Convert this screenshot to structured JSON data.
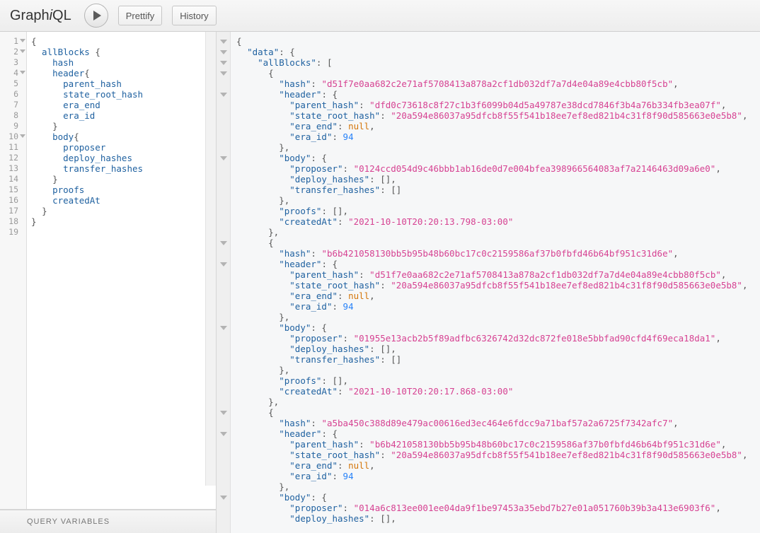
{
  "header": {
    "logo_graph": "Graph",
    "logo_i": "i",
    "logo_ql": "QL",
    "execute_label": "",
    "prettify_label": "Prettify",
    "history_label": "History"
  },
  "editor": {
    "variables_label": "QUERY VARIABLES",
    "lines": [
      {
        "n": "1",
        "fold": true,
        "text": "{"
      },
      {
        "n": "2",
        "fold": true,
        "text": "  allBlocks {"
      },
      {
        "n": "3",
        "fold": false,
        "text": "    hash"
      },
      {
        "n": "4",
        "fold": true,
        "text": "    header{"
      },
      {
        "n": "5",
        "fold": false,
        "text": "      parent_hash"
      },
      {
        "n": "6",
        "fold": false,
        "text": "      state_root_hash"
      },
      {
        "n": "7",
        "fold": false,
        "text": "      era_end"
      },
      {
        "n": "8",
        "fold": false,
        "text": "      era_id"
      },
      {
        "n": "9",
        "fold": false,
        "text": "    }"
      },
      {
        "n": "10",
        "fold": true,
        "text": "    body{"
      },
      {
        "n": "11",
        "fold": false,
        "text": "      proposer"
      },
      {
        "n": "12",
        "fold": false,
        "text": "      deploy_hashes"
      },
      {
        "n": "13",
        "fold": false,
        "text": "      transfer_hashes"
      },
      {
        "n": "14",
        "fold": false,
        "text": "    }"
      },
      {
        "n": "15",
        "fold": false,
        "text": "    proofs"
      },
      {
        "n": "16",
        "fold": false,
        "text": "    createdAt"
      },
      {
        "n": "17",
        "fold": false,
        "text": "  }"
      },
      {
        "n": "18",
        "fold": false,
        "text": "}"
      },
      {
        "n": "19",
        "fold": false,
        "text": ""
      }
    ]
  },
  "result": {
    "lines": [
      {
        "fold": true,
        "indent": 0,
        "parts": [
          {
            "t": "{",
            "c": "p"
          }
        ]
      },
      {
        "fold": true,
        "indent": 1,
        "parts": [
          {
            "t": "\"data\"",
            "c": "k"
          },
          {
            "t": ": {",
            "c": "p"
          }
        ]
      },
      {
        "fold": true,
        "indent": 2,
        "parts": [
          {
            "t": "\"allBlocks\"",
            "c": "k"
          },
          {
            "t": ": [",
            "c": "p"
          }
        ]
      },
      {
        "fold": true,
        "indent": 3,
        "parts": [
          {
            "t": "{",
            "c": "p"
          }
        ]
      },
      {
        "fold": false,
        "indent": 4,
        "parts": [
          {
            "t": "\"hash\"",
            "c": "k"
          },
          {
            "t": ": ",
            "c": "p"
          },
          {
            "t": "\"d51f7e0aa682c2e71af5708413a878a2cf1db032df7a7d4e04a89e4cbb80f5cb\"",
            "c": "s"
          },
          {
            "t": ",",
            "c": "p"
          }
        ]
      },
      {
        "fold": true,
        "indent": 4,
        "parts": [
          {
            "t": "\"header\"",
            "c": "k"
          },
          {
            "t": ": {",
            "c": "p"
          }
        ]
      },
      {
        "fold": false,
        "indent": 5,
        "parts": [
          {
            "t": "\"parent_hash\"",
            "c": "k"
          },
          {
            "t": ": ",
            "c": "p"
          },
          {
            "t": "\"dfd0c73618c8f27c1b3f6099b04d5a49787e38dcd7846f3b4a76b334fb3ea07f\"",
            "c": "s"
          },
          {
            "t": ",",
            "c": "p"
          }
        ]
      },
      {
        "fold": false,
        "indent": 5,
        "parts": [
          {
            "t": "\"state_root_hash\"",
            "c": "k"
          },
          {
            "t": ": ",
            "c": "p"
          },
          {
            "t": "\"20a594e86037a95dfcb8f55f541b18ee7ef8ed821b4c31f8f90d585663e0e5b8\"",
            "c": "s"
          },
          {
            "t": ",",
            "c": "p"
          }
        ]
      },
      {
        "fold": false,
        "indent": 5,
        "parts": [
          {
            "t": "\"era_end\"",
            "c": "k"
          },
          {
            "t": ": ",
            "c": "p"
          },
          {
            "t": "null",
            "c": "nul"
          },
          {
            "t": ",",
            "c": "p"
          }
        ]
      },
      {
        "fold": false,
        "indent": 5,
        "parts": [
          {
            "t": "\"era_id\"",
            "c": "k"
          },
          {
            "t": ": ",
            "c": "p"
          },
          {
            "t": "94",
            "c": "n"
          }
        ]
      },
      {
        "fold": false,
        "indent": 4,
        "parts": [
          {
            "t": "},",
            "c": "p"
          }
        ]
      },
      {
        "fold": true,
        "indent": 4,
        "parts": [
          {
            "t": "\"body\"",
            "c": "k"
          },
          {
            "t": ": {",
            "c": "p"
          }
        ]
      },
      {
        "fold": false,
        "indent": 5,
        "parts": [
          {
            "t": "\"proposer\"",
            "c": "k"
          },
          {
            "t": ": ",
            "c": "p"
          },
          {
            "t": "\"0124ccd054d9c46bbb1ab16de0d7e004bfea398966564083af7a2146463d09a6e0\"",
            "c": "s"
          },
          {
            "t": ",",
            "c": "p"
          }
        ]
      },
      {
        "fold": false,
        "indent": 5,
        "parts": [
          {
            "t": "\"deploy_hashes\"",
            "c": "k"
          },
          {
            "t": ": [],",
            "c": "p"
          }
        ]
      },
      {
        "fold": false,
        "indent": 5,
        "parts": [
          {
            "t": "\"transfer_hashes\"",
            "c": "k"
          },
          {
            "t": ": []",
            "c": "p"
          }
        ]
      },
      {
        "fold": false,
        "indent": 4,
        "parts": [
          {
            "t": "},",
            "c": "p"
          }
        ]
      },
      {
        "fold": false,
        "indent": 4,
        "parts": [
          {
            "t": "\"proofs\"",
            "c": "k"
          },
          {
            "t": ": [],",
            "c": "p"
          }
        ]
      },
      {
        "fold": false,
        "indent": 4,
        "parts": [
          {
            "t": "\"createdAt\"",
            "c": "k"
          },
          {
            "t": ": ",
            "c": "p"
          },
          {
            "t": "\"2021-10-10T20:20:13.798-03:00\"",
            "c": "s"
          }
        ]
      },
      {
        "fold": false,
        "indent": 3,
        "parts": [
          {
            "t": "},",
            "c": "p"
          }
        ]
      },
      {
        "fold": true,
        "indent": 3,
        "parts": [
          {
            "t": "{",
            "c": "p"
          }
        ]
      },
      {
        "fold": false,
        "indent": 4,
        "parts": [
          {
            "t": "\"hash\"",
            "c": "k"
          },
          {
            "t": ": ",
            "c": "p"
          },
          {
            "t": "\"b6b421058130bb5b95b48b60bc17c0c2159586af37b0fbfd46b64bf951c31d6e\"",
            "c": "s"
          },
          {
            "t": ",",
            "c": "p"
          }
        ]
      },
      {
        "fold": true,
        "indent": 4,
        "parts": [
          {
            "t": "\"header\"",
            "c": "k"
          },
          {
            "t": ": {",
            "c": "p"
          }
        ]
      },
      {
        "fold": false,
        "indent": 5,
        "parts": [
          {
            "t": "\"parent_hash\"",
            "c": "k"
          },
          {
            "t": ": ",
            "c": "p"
          },
          {
            "t": "\"d51f7e0aa682c2e71af5708413a878a2cf1db032df7a7d4e04a89e4cbb80f5cb\"",
            "c": "s"
          },
          {
            "t": ",",
            "c": "p"
          }
        ]
      },
      {
        "fold": false,
        "indent": 5,
        "parts": [
          {
            "t": "\"state_root_hash\"",
            "c": "k"
          },
          {
            "t": ": ",
            "c": "p"
          },
          {
            "t": "\"20a594e86037a95dfcb8f55f541b18ee7ef8ed821b4c31f8f90d585663e0e5b8\"",
            "c": "s"
          },
          {
            "t": ",",
            "c": "p"
          }
        ]
      },
      {
        "fold": false,
        "indent": 5,
        "parts": [
          {
            "t": "\"era_end\"",
            "c": "k"
          },
          {
            "t": ": ",
            "c": "p"
          },
          {
            "t": "null",
            "c": "nul"
          },
          {
            "t": ",",
            "c": "p"
          }
        ]
      },
      {
        "fold": false,
        "indent": 5,
        "parts": [
          {
            "t": "\"era_id\"",
            "c": "k"
          },
          {
            "t": ": ",
            "c": "p"
          },
          {
            "t": "94",
            "c": "n"
          }
        ]
      },
      {
        "fold": false,
        "indent": 4,
        "parts": [
          {
            "t": "},",
            "c": "p"
          }
        ]
      },
      {
        "fold": true,
        "indent": 4,
        "parts": [
          {
            "t": "\"body\"",
            "c": "k"
          },
          {
            "t": ": {",
            "c": "p"
          }
        ]
      },
      {
        "fold": false,
        "indent": 5,
        "parts": [
          {
            "t": "\"proposer\"",
            "c": "k"
          },
          {
            "t": ": ",
            "c": "p"
          },
          {
            "t": "\"01955e13acb2b5f89adfbc6326742d32dc872fe018e5bbfad90cfd4f69eca18da1\"",
            "c": "s"
          },
          {
            "t": ",",
            "c": "p"
          }
        ]
      },
      {
        "fold": false,
        "indent": 5,
        "parts": [
          {
            "t": "\"deploy_hashes\"",
            "c": "k"
          },
          {
            "t": ": [],",
            "c": "p"
          }
        ]
      },
      {
        "fold": false,
        "indent": 5,
        "parts": [
          {
            "t": "\"transfer_hashes\"",
            "c": "k"
          },
          {
            "t": ": []",
            "c": "p"
          }
        ]
      },
      {
        "fold": false,
        "indent": 4,
        "parts": [
          {
            "t": "},",
            "c": "p"
          }
        ]
      },
      {
        "fold": false,
        "indent": 4,
        "parts": [
          {
            "t": "\"proofs\"",
            "c": "k"
          },
          {
            "t": ": [],",
            "c": "p"
          }
        ]
      },
      {
        "fold": false,
        "indent": 4,
        "parts": [
          {
            "t": "\"createdAt\"",
            "c": "k"
          },
          {
            "t": ": ",
            "c": "p"
          },
          {
            "t": "\"2021-10-10T20:20:17.868-03:00\"",
            "c": "s"
          }
        ]
      },
      {
        "fold": false,
        "indent": 3,
        "parts": [
          {
            "t": "},",
            "c": "p"
          }
        ]
      },
      {
        "fold": true,
        "indent": 3,
        "parts": [
          {
            "t": "{",
            "c": "p"
          }
        ]
      },
      {
        "fold": false,
        "indent": 4,
        "parts": [
          {
            "t": "\"hash\"",
            "c": "k"
          },
          {
            "t": ": ",
            "c": "p"
          },
          {
            "t": "\"a5ba450c388d89e479ac00616ed3ec464e6fdcc9a71baf57a2a6725f7342afc7\"",
            "c": "s"
          },
          {
            "t": ",",
            "c": "p"
          }
        ]
      },
      {
        "fold": true,
        "indent": 4,
        "parts": [
          {
            "t": "\"header\"",
            "c": "k"
          },
          {
            "t": ": {",
            "c": "p"
          }
        ]
      },
      {
        "fold": false,
        "indent": 5,
        "parts": [
          {
            "t": "\"parent_hash\"",
            "c": "k"
          },
          {
            "t": ": ",
            "c": "p"
          },
          {
            "t": "\"b6b421058130bb5b95b48b60bc17c0c2159586af37b0fbfd46b64bf951c31d6e\"",
            "c": "s"
          },
          {
            "t": ",",
            "c": "p"
          }
        ]
      },
      {
        "fold": false,
        "indent": 5,
        "parts": [
          {
            "t": "\"state_root_hash\"",
            "c": "k"
          },
          {
            "t": ": ",
            "c": "p"
          },
          {
            "t": "\"20a594e86037a95dfcb8f55f541b18ee7ef8ed821b4c31f8f90d585663e0e5b8\"",
            "c": "s"
          },
          {
            "t": ",",
            "c": "p"
          }
        ]
      },
      {
        "fold": false,
        "indent": 5,
        "parts": [
          {
            "t": "\"era_end\"",
            "c": "k"
          },
          {
            "t": ": ",
            "c": "p"
          },
          {
            "t": "null",
            "c": "nul"
          },
          {
            "t": ",",
            "c": "p"
          }
        ]
      },
      {
        "fold": false,
        "indent": 5,
        "parts": [
          {
            "t": "\"era_id\"",
            "c": "k"
          },
          {
            "t": ": ",
            "c": "p"
          },
          {
            "t": "94",
            "c": "n"
          }
        ]
      },
      {
        "fold": false,
        "indent": 4,
        "parts": [
          {
            "t": "},",
            "c": "p"
          }
        ]
      },
      {
        "fold": true,
        "indent": 4,
        "parts": [
          {
            "t": "\"body\"",
            "c": "k"
          },
          {
            "t": ": {",
            "c": "p"
          }
        ]
      },
      {
        "fold": false,
        "indent": 5,
        "parts": [
          {
            "t": "\"proposer\"",
            "c": "k"
          },
          {
            "t": ": ",
            "c": "p"
          },
          {
            "t": "\"014a6c813ee001ee04da9f1be97453a35ebd7b27e01a051760b39b3a413e6903f6\"",
            "c": "s"
          },
          {
            "t": ",",
            "c": "p"
          }
        ]
      },
      {
        "fold": false,
        "indent": 5,
        "parts": [
          {
            "t": "\"deploy_hashes\"",
            "c": "k"
          },
          {
            "t": ": [],",
            "c": "p"
          }
        ]
      }
    ]
  }
}
